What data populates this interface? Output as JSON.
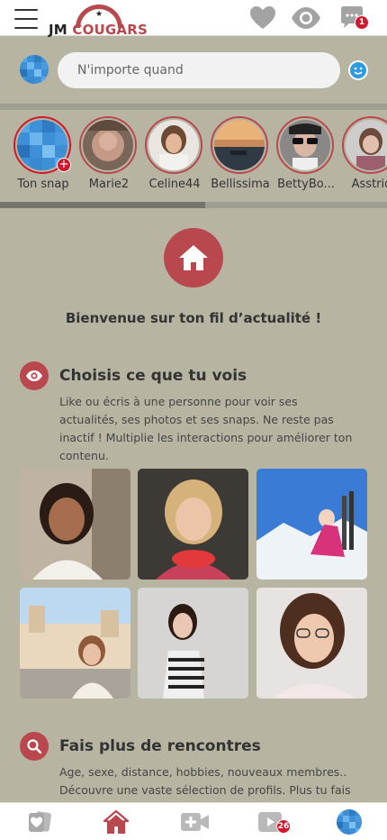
{
  "header": {
    "logo_jm": "JM",
    "logo_cougars": "COUGARS",
    "messages_badge": "1"
  },
  "post": {
    "placeholder": "N'importe quand"
  },
  "stories": [
    {
      "name": "Ton snap",
      "has_add": true
    },
    {
      "name": "Marie2"
    },
    {
      "name": "Celine44"
    },
    {
      "name": "Bellissima"
    },
    {
      "name": "BettyBo..."
    },
    {
      "name": "Asstrid"
    }
  ],
  "welcome": {
    "title": "Bienvenue sur ton fil d’actualité !"
  },
  "section_choose": {
    "title": "Choisis ce que tu vois",
    "description": "Like ou écris à une personne pour voir ses actualités, ses photos et ses snaps. Ne reste pas inactif ! Multiplie les interactions pour améliorer ton contenu."
  },
  "section_meet": {
    "title": "Fais plus de rencontres",
    "description": "Age, sexe, distance, hobbies, nouveaux membres.. Découvre une vaste sélection de profils. Plus tu fais"
  },
  "bottom_nav": {
    "videos_badge": "26"
  },
  "colors": {
    "brand": "#b8484e",
    "background": "#b7b5a2",
    "badge": "#d0182c"
  }
}
